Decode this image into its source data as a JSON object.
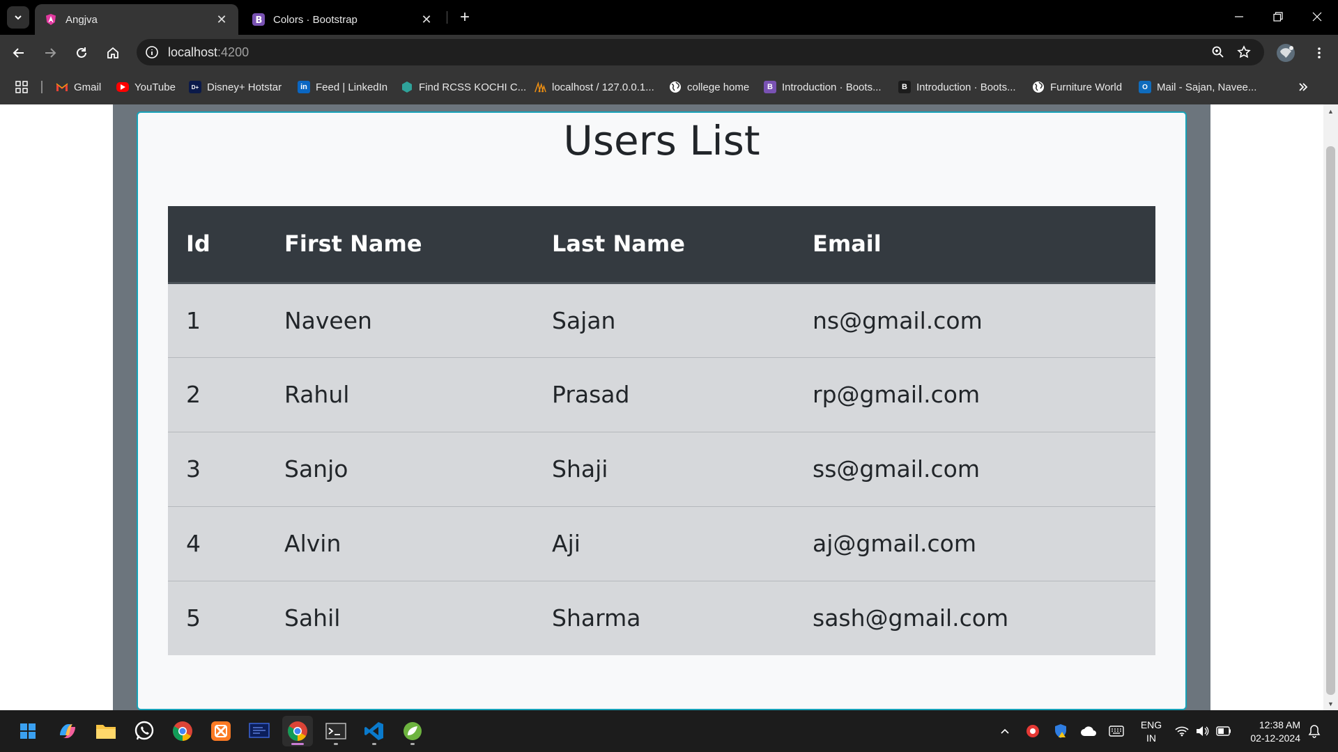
{
  "browser": {
    "tabs": [
      {
        "title": "Angjva",
        "active": true,
        "icon": "angular-icon"
      },
      {
        "title": "Colors · Bootstrap",
        "active": false,
        "icon": "bootstrap-icon"
      }
    ],
    "address": {
      "host": "localhost",
      "port": ":4200"
    },
    "bookmarks": [
      {
        "label": "Gmail",
        "icon": "gmail-icon"
      },
      {
        "label": "YouTube",
        "icon": "youtube-icon"
      },
      {
        "label": "Disney+ Hotstar",
        "icon": "hotstar-icon"
      },
      {
        "label": "Feed | LinkedIn",
        "icon": "linkedin-icon"
      },
      {
        "label": "Find RCSS KOCHI C...",
        "icon": "hexagon-icon"
      },
      {
        "label": "localhost / 127.0.0.1...",
        "icon": "phpmyadmin-icon"
      },
      {
        "label": "college home",
        "icon": "globe-icon"
      },
      {
        "label": "Introduction · Boots...",
        "icon": "bootstrap-icon"
      },
      {
        "label": "Introduction · Boots...",
        "icon": "bootstrap-icon"
      },
      {
        "label": "Furniture World",
        "icon": "globe-icon"
      },
      {
        "label": "Mail - Sajan, Navee...",
        "icon": "outlook-icon"
      }
    ]
  },
  "page": {
    "title": "Users List",
    "table": {
      "headers": [
        "Id",
        "First Name",
        "Last Name",
        "Email"
      ],
      "rows": [
        [
          "1",
          "Naveen",
          "Sajan",
          "ns@gmail.com"
        ],
        [
          "2",
          "Rahul",
          "Prasad",
          "rp@gmail.com"
        ],
        [
          "3",
          "Sanjo",
          "Shaji",
          "ss@gmail.com"
        ],
        [
          "4",
          "Alvin",
          "Aji",
          "aj@gmail.com"
        ],
        [
          "5",
          "Sahil",
          "Sharma",
          "sash@gmail.com"
        ]
      ]
    }
  },
  "taskbar": {
    "language": {
      "line1": "ENG",
      "line2": "IN"
    },
    "time": "12:38 AM",
    "date": "02-12-2024"
  },
  "colors": {
    "table_header": "#343a40",
    "table_row": "#d6d8db",
    "card_border": "#17a2b8",
    "page_band": "#6c757d"
  }
}
